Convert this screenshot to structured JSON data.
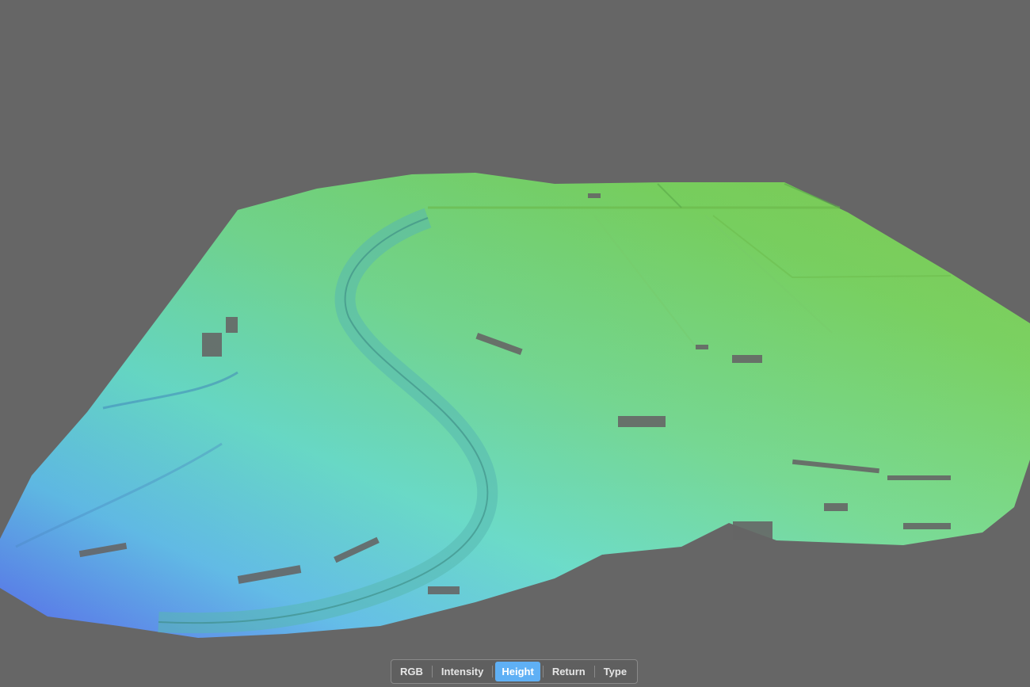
{
  "viewer": {
    "background_color": "#666666",
    "colormap": {
      "low": "#4a62e8",
      "mid": "#5fd8c8",
      "high": "#7fdc5a"
    }
  },
  "color_modes": {
    "items": [
      {
        "id": "rgb",
        "label": "RGB"
      },
      {
        "id": "intensity",
        "label": "Intensity"
      },
      {
        "id": "height",
        "label": "Height"
      },
      {
        "id": "return",
        "label": "Return"
      },
      {
        "id": "type",
        "label": "Type"
      }
    ],
    "selected": "Height",
    "active_color": "#5fb0f5"
  }
}
